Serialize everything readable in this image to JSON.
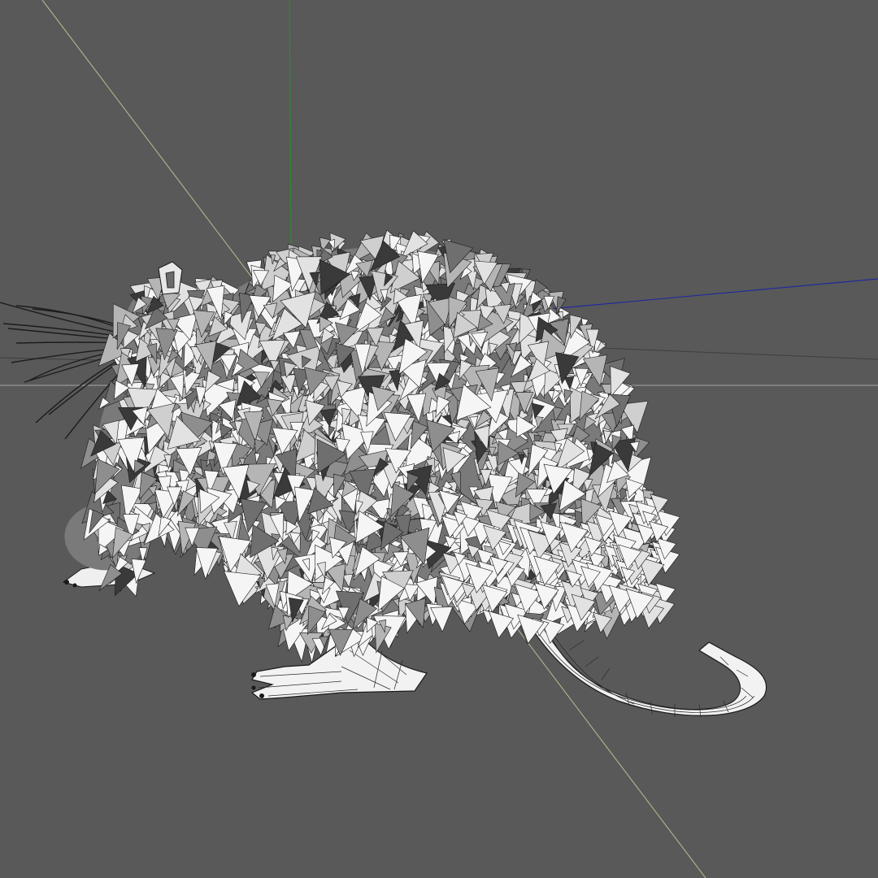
{
  "viewport": {
    "background": "#595959",
    "model": "rat-wireframe",
    "shading": "wireframe-on-shaded",
    "axes": {
      "x_color": "#1f2a9a",
      "y_color": "#2f8a2f",
      "z_color": "#b8b38a",
      "horizon_color": "#a9a9a9"
    },
    "mesh": {
      "fill_colors": [
        "#f5f5f5",
        "#e2e2e2",
        "#cfcfcf",
        "#b5b5b5",
        "#8e8e8e",
        "#6f6f6f",
        "#3a3a3a"
      ],
      "edge_color": "#1a1a1a"
    }
  }
}
